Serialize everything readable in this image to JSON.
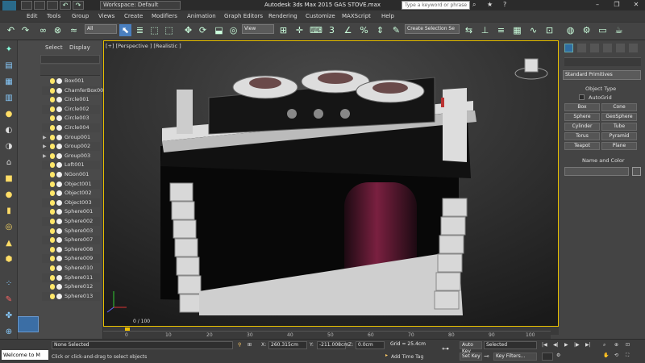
{
  "app": {
    "logo_text": "MAX",
    "workspace": "Workspace: Default",
    "title": "Autodesk 3ds Max  2015     GAS STOVE.max",
    "search_placeholder": "Type a keyword or phrase"
  },
  "menu": [
    "Edit",
    "Tools",
    "Group",
    "Views",
    "Create",
    "Modifiers",
    "Animation",
    "Graph Editors",
    "Rendering",
    "Customize",
    "MAXScript",
    "Help"
  ],
  "toolbar": {
    "selection_filter": "All",
    "view_dropdown": "View",
    "selection_set": "Create Selection Se"
  },
  "scene_explorer": {
    "tabs": [
      "Select",
      "Display"
    ],
    "items": [
      {
        "name": "Box001",
        "group": false
      },
      {
        "name": "ChamferBox00",
        "group": false
      },
      {
        "name": "Circle001",
        "group": false
      },
      {
        "name": "Circle002",
        "group": false
      },
      {
        "name": "Circle003",
        "group": false
      },
      {
        "name": "Circle004",
        "group": false
      },
      {
        "name": "Group001",
        "group": true
      },
      {
        "name": "Group002",
        "group": true
      },
      {
        "name": "Group003",
        "group": true
      },
      {
        "name": "Loft001",
        "group": false
      },
      {
        "name": "NGon001",
        "group": false
      },
      {
        "name": "Object001",
        "group": false
      },
      {
        "name": "Object002",
        "group": false
      },
      {
        "name": "Object003",
        "group": false
      },
      {
        "name": "Sphere001",
        "group": false
      },
      {
        "name": "Sphere002",
        "group": false
      },
      {
        "name": "Sphere003",
        "group": false
      },
      {
        "name": "Sphere007",
        "group": false
      },
      {
        "name": "Sphere008",
        "group": false
      },
      {
        "name": "Sphere009",
        "group": false
      },
      {
        "name": "Sphere010",
        "group": false
      },
      {
        "name": "Sphere011",
        "group": false
      },
      {
        "name": "Sphere012",
        "group": false
      },
      {
        "name": "Sphere013",
        "group": false
      }
    ]
  },
  "viewport": {
    "label": "[+] [Perspective ] [Realistic ]"
  },
  "command_panel": {
    "dropdown": "Standard Primitives",
    "object_type_title": "Object Type",
    "autogrid": "AutoGrid",
    "buttons": [
      "Box",
      "Cone",
      "Sphere",
      "GeoSphere",
      "Cylinder",
      "Tube",
      "Torus",
      "Pyramid",
      "Teapot",
      "Plane"
    ],
    "name_color_title": "Name and Color"
  },
  "timeline": {
    "frame": "0 / 100",
    "ticks": [
      "0",
      "10",
      "20",
      "30",
      "40",
      "50",
      "60",
      "70",
      "80",
      "90",
      "100"
    ]
  },
  "status": {
    "listener": "Welcome to M",
    "selection": "None Selected",
    "prompt": "Click or click-and-drag to select objects",
    "x": "260.315cm",
    "y": "-211.008cm",
    "z": "0.0cm",
    "grid": "Grid = 25.4cm",
    "add_time_tag": "Add Time Tag",
    "auto_key": "Auto Key",
    "set_key": "Set Key",
    "selected": "Selected",
    "key_filters": "Key Filters..."
  }
}
